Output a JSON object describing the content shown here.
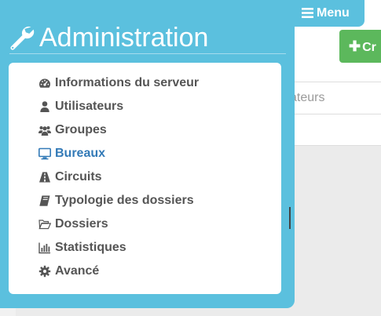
{
  "background": {
    "column_header_partial": "ateurs",
    "create_button_partial": "Cr"
  },
  "menu_button": {
    "label": "Menu",
    "icon": "bars-icon"
  },
  "admin": {
    "title": "Administration",
    "title_icon": "wrench-icon",
    "items": [
      {
        "label": "Informations du serveur",
        "icon": "dashboard-icon",
        "active": false
      },
      {
        "label": "Utilisateurs",
        "icon": "user-icon",
        "active": false
      },
      {
        "label": "Groupes",
        "icon": "users-icon",
        "active": false
      },
      {
        "label": "Bureaux",
        "icon": "desktop-icon",
        "active": true
      },
      {
        "label": "Circuits",
        "icon": "road-icon",
        "active": false
      },
      {
        "label": "Typologie des dossiers",
        "icon": "book-icon",
        "active": false
      },
      {
        "label": "Dossiers",
        "icon": "folder-open-icon",
        "active": false
      },
      {
        "label": "Statistiques",
        "icon": "bar-chart-icon",
        "active": false
      },
      {
        "label": "Avancé",
        "icon": "gear-icon",
        "active": false
      }
    ]
  },
  "colors": {
    "panel_accent": "#5bc0de",
    "active_link": "#337ab7",
    "item_text": "#555555",
    "create_button": "#5cb85c"
  }
}
